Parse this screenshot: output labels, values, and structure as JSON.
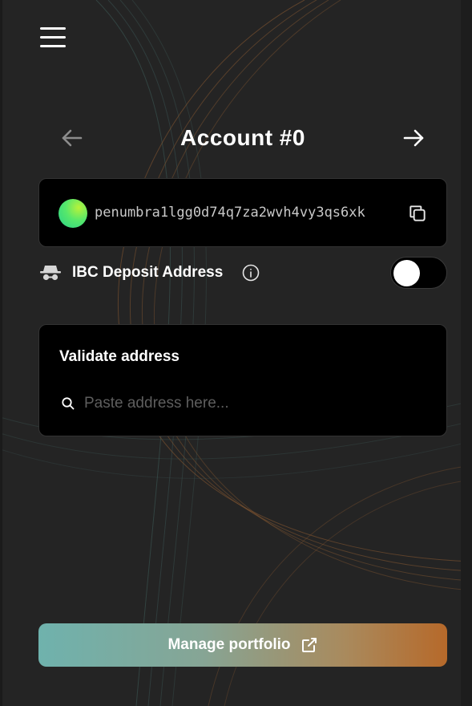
{
  "header": {
    "menu_icon": "hamburger-menu-icon"
  },
  "account": {
    "title": "Account #0",
    "prev_icon": "arrow-left-icon",
    "next_icon": "arrow-right-icon"
  },
  "address": {
    "value": "penumbra1lgg0d74q7za2wvh4vy3qs6xk",
    "avatar_colors": [
      "#b8f23a",
      "#28d28a"
    ],
    "copy_icon": "copy-icon"
  },
  "ibc": {
    "label": "IBC Deposit Address",
    "toggle_on": false,
    "icon": "spy-icon",
    "info_icon": "info-icon"
  },
  "validate": {
    "title": "Validate address",
    "placeholder": "Paste address here...",
    "search_icon": "search-icon"
  },
  "footer": {
    "manage_label": "Manage portfolio",
    "external_icon": "external-link-icon",
    "gradient": [
      "#6fb2ad",
      "#b6692a"
    ]
  },
  "theme": {
    "background": "#242424",
    "card": "#000000"
  }
}
